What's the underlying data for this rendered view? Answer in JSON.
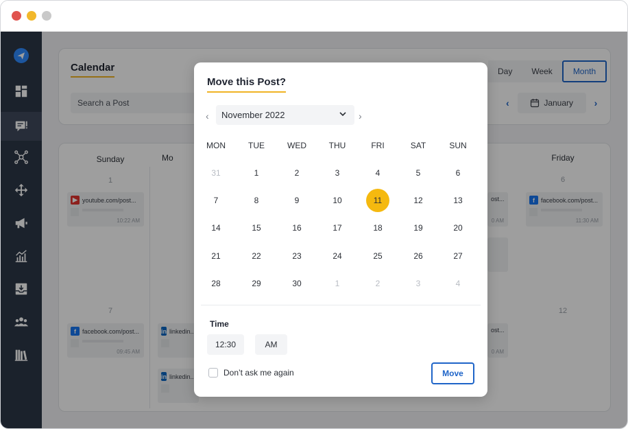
{
  "app": {
    "page_title": "Calendar",
    "search_placeholder": "Search a Post",
    "view_tabs": [
      "Day",
      "Week",
      "Month"
    ],
    "active_view": "Month",
    "current_month": "January",
    "colors": {
      "accent": "#1e64c8",
      "highlight": "#f0b323",
      "sidebar": "#2d3748"
    }
  },
  "sidebar": {
    "items": [
      {
        "icon": "send-logo-icon"
      },
      {
        "icon": "dashboard-icon"
      },
      {
        "icon": "posts-icon"
      },
      {
        "icon": "network-icon"
      },
      {
        "icon": "move-arrows-icon"
      },
      {
        "icon": "megaphone-icon"
      },
      {
        "icon": "analytics-icon"
      },
      {
        "icon": "inbox-download-icon"
      },
      {
        "icon": "users-icon"
      },
      {
        "icon": "library-icon"
      }
    ]
  },
  "calendar": {
    "columns": [
      {
        "name": "Sunday",
        "dates": [
          "1",
          "7"
        ]
      },
      {
        "name": "Mo",
        "dates": []
      },
      {
        "name": "Friday",
        "dates": [
          "6",
          "12"
        ]
      }
    ],
    "posts": [
      {
        "network": "youtube",
        "text": "youtube.com/post...",
        "time": "10:22 AM"
      },
      {
        "network": "facebook",
        "text": "facebook.com/post...",
        "time": "11:30 AM"
      },
      {
        "network": "facebook",
        "text": "facebook.com/post...",
        "time": "09:45 AM"
      },
      {
        "network": "linkedin",
        "text": "linkedin...",
        "time": ""
      },
      {
        "network": "linkedin",
        "text": "linkedin...",
        "time": ""
      },
      {
        "network": "other",
        "text": "ost...",
        "time": "0 AM"
      },
      {
        "network": "other",
        "text": "ost...",
        "time": "0 AM"
      }
    ]
  },
  "modal": {
    "title": "Move this Post?",
    "month_value": "November 2022",
    "weekdays": [
      "MON",
      "TUE",
      "WED",
      "THU",
      "FRI",
      "SAT",
      "SUN"
    ],
    "weeks": [
      [
        "31",
        "1",
        "2",
        "3",
        "4",
        "5",
        "6"
      ],
      [
        "7",
        "8",
        "9",
        "10",
        "11",
        "12",
        "13"
      ],
      [
        "14",
        "15",
        "16",
        "17",
        "18",
        "19",
        "20"
      ],
      [
        "21",
        "22",
        "23",
        "24",
        "25",
        "26",
        "27"
      ],
      [
        "28",
        "29",
        "30",
        "1",
        "2",
        "3",
        "4"
      ]
    ],
    "selected_day": "11",
    "time_label": "Time",
    "time_value": "12:30",
    "ampm_value": "AM",
    "dont_ask_label": "Don’t ask me again",
    "dont_ask_checked": false,
    "move_label": "Move"
  }
}
